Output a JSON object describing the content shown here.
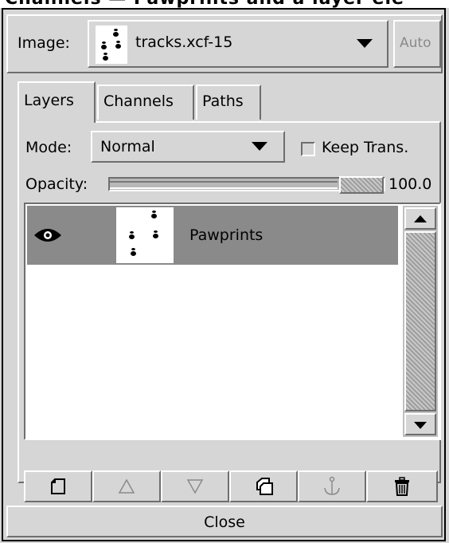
{
  "image_selector": {
    "label": "Image:",
    "value": "tracks.xcf-15",
    "auto_label": "Auto"
  },
  "tabs": [
    {
      "label": "Layers",
      "active": true
    },
    {
      "label": "Channels",
      "active": false
    },
    {
      "label": "Paths",
      "active": false
    }
  ],
  "mode": {
    "label": "Mode:",
    "value": "Normal"
  },
  "keep_trans": {
    "label": "Keep Trans.",
    "checked": false
  },
  "opacity": {
    "label": "Opacity:",
    "value": "100.0",
    "level": 1.0
  },
  "layers": [
    {
      "name": "Pawprints",
      "visible": true,
      "selected": true
    }
  ],
  "toolbar": {
    "icons": [
      "new-layer-icon",
      "raise-layer-icon",
      "lower-layer-icon",
      "duplicate-layer-icon",
      "anchor-layer-icon",
      "delete-layer-icon"
    ]
  },
  "close_label": "Close",
  "colors": {
    "selected_row": "#8a8a8a",
    "background": "#d6d6d6"
  }
}
